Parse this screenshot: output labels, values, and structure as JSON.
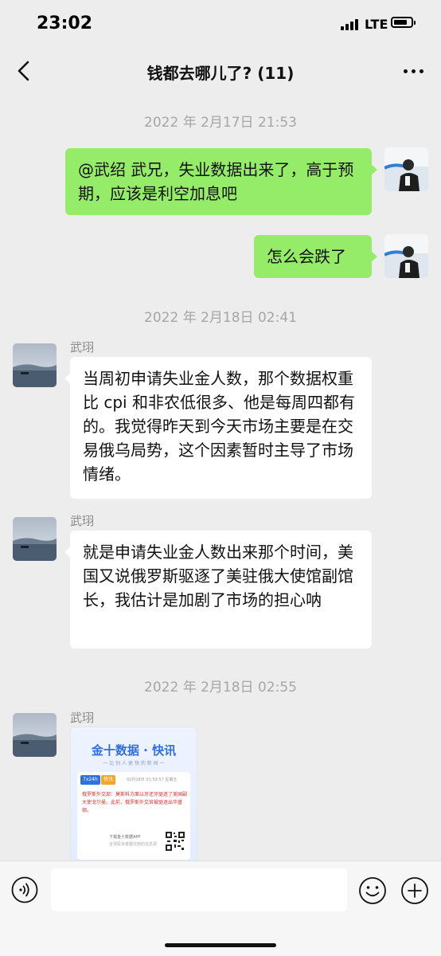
{
  "status_bar": {
    "time": "23:02",
    "network": "LTE",
    "battery_level": 0.8
  },
  "header": {
    "title": "钱都去哪儿了? (11)"
  },
  "messages": [
    {
      "type": "timestamp",
      "text": "2022 年 2月17日 21:53"
    },
    {
      "type": "self",
      "text": "@武绍 武兄，失业数据出来了，高于预期，应该是利空加息吧"
    },
    {
      "type": "self",
      "text": "怎么会跌了"
    },
    {
      "type": "timestamp",
      "text": "2022 年 2月18日 02:41"
    },
    {
      "type": "other",
      "sender": "武珝",
      "text": "当周初申请失业金人数，那个数据权重比 cpi 和非农低很多、他是每周四都有的。我觉得昨天到今天市场主要是在交易俄乌局势，这个因素暂时主导了市场情绪。"
    },
    {
      "type": "other",
      "sender": "武珝",
      "text": "就是申请失业金人数出来那个时间，美国又说俄罗斯驱逐了美驻俄大使馆副馆长，我估计是加剧了市场的担心呐"
    },
    {
      "type": "timestamp",
      "text": "2022 年 2月18日 02:55"
    },
    {
      "type": "other-card",
      "sender": "武珝",
      "card": {
        "brand": "金十数据 · 快讯",
        "slogan": "一 比 别 人 更 快 的 新 闻 一",
        "tag1": "7x24h",
        "tag2": "快讯",
        "date": "02月18日 01:59:57 星期五",
        "news": "俄罗斯外交部：莫斯科方面以牙还牙驱逐了美国副大使戈尔曼。此前，俄罗斯外交官被驱逐出华盛顿。",
        "download": "下载金十数据APP",
        "download_sub": "全球投资者都在用的信息源"
      }
    }
  ],
  "input": {
    "value": ""
  },
  "icons": {
    "back": "chevron-left-icon",
    "more": "more-icon",
    "voice": "voice-icon",
    "emoji": "emoji-icon",
    "plus": "plus-icon"
  }
}
